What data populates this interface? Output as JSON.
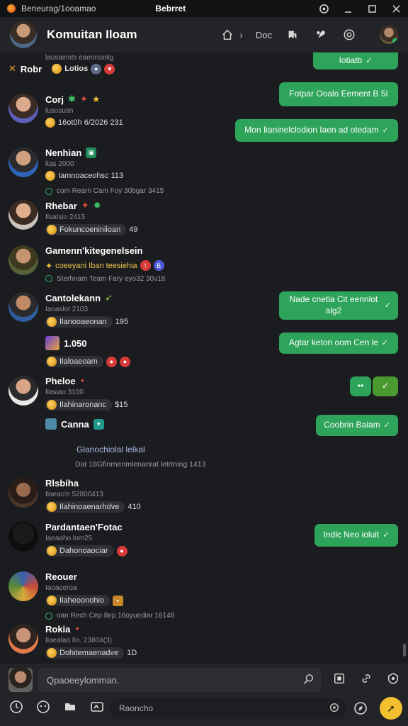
{
  "window": {
    "app_title": "Beneurag/1ooamao",
    "doc_title": "Bebrret",
    "controls": [
      "min",
      "max",
      "close"
    ]
  },
  "header": {
    "title": "Komuitan Iloam",
    "nav_label": "Doc"
  },
  "colors": {
    "bubble_green": "#2ea35a",
    "background": "#1b1c1f",
    "accent_yellow": "#f4c030"
  },
  "messages": [
    {
      "name": "Robr",
      "sub": "lausainsts eaeorcaslg",
      "reaction": "Lotios",
      "prefix": "✕"
    },
    {
      "name": "Corj",
      "sub": "lusosusn",
      "reaction": "16ot0h 6/2026 231"
    },
    {
      "name": "Nenhian",
      "sub": "ltas 2000",
      "reaction": "Iamnoaceohsc 113",
      "thread": "com Rearn Cam Foy 30bgar 3415"
    },
    {
      "name": "Rhebar",
      "sub": "Ilsatsio 2415",
      "reaction": "Fokuncoeniniioan",
      "count": "49"
    },
    {
      "name": "Gamenn'kitegenelsein",
      "sub": "coeeyani Iban teesiehia",
      "thread": "Sterhnam Team Fary eyo32 30v18"
    },
    {
      "name": "Cantolekann",
      "sub": "Iaoaslot 2103",
      "reaction": "Ilanooaeonan",
      "count": "195"
    },
    {
      "name": "1.050",
      "reaction": "Ilaloaeoam"
    },
    {
      "name": "Pheloe",
      "sub": "Ilasiao 3100",
      "reaction": "Ilahinaronanc",
      "count": "$15"
    },
    {
      "name": "Canna"
    },
    {
      "name": "Rlsbiha",
      "sub": "Ilaeao'e 52800413",
      "reaction": "Ilahinoaenarhdve",
      "count": "410"
    },
    {
      "name": "Pardantaen'Fotac",
      "sub": "Iaeaaho lom25",
      "reaction": "Dahonoaociar"
    },
    {
      "name": "Reouer",
      "sub": "Iaoaceroa",
      "reaction": "Ilaheoonohio",
      "thread": "oan Rech Cep 8ep 16oyuediar 16148"
    },
    {
      "name": "Rokia",
      "sub": "Ilaealao Ilo. 23804(3)",
      "reaction": "Dohitemaenadve",
      "count": "1D"
    }
  ],
  "notice": {
    "title": "Glanochiolal lelkal",
    "detail": "Dat 18Gfinrnenmlenanrat letrtning 1413"
  },
  "bubbles": [
    {
      "text": "Iotiatb"
    },
    {
      "text": "Fotpar Ooalo Eement B 5I"
    },
    {
      "text": "Mon Iianinelclodion Iaen ad otedam"
    },
    {
      "text": "Nade cnetla Cit eennlot alg2"
    },
    {
      "text": "Agtar keton oom Cen le"
    },
    {
      "text": "••"
    },
    {
      "text": "✓"
    },
    {
      "text": "Coobrin Baiam"
    },
    {
      "text": "Indlc Neo ioluit"
    }
  ],
  "composer": {
    "placeholder": "Qpaoeeylomman.",
    "search_placeholder": "Raoncho"
  }
}
